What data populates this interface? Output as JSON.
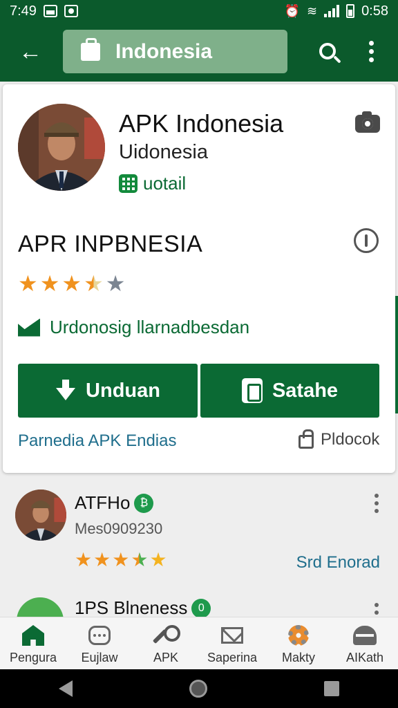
{
  "status_bar": {
    "time": "7:49",
    "battery_time": "0:58"
  },
  "app_bar": {
    "search_text": "Indonesia"
  },
  "app_card": {
    "title": "APK Indonesia",
    "subtitle": "Uidonesia",
    "badge_text": "uotail",
    "section_title": "APR INPBNESIA",
    "rating": 3.5,
    "rating_max": 5,
    "verified_text": "Urdonosig llarnadbesdan",
    "download_button": "Unduan",
    "save_button": "Satahe",
    "footer_link": "Parnedia APK Endias",
    "footer_lock_text": "Pldocok"
  },
  "list": [
    {
      "name": "ATFHo",
      "badge": "₿",
      "subtitle": "Mes0909230",
      "rating": 4.5,
      "action": "Srd Enorad"
    },
    {
      "name": "1PS Blneness",
      "badge": "0"
    }
  ],
  "bottom_nav": [
    {
      "label": "Pengura",
      "icon": "home-icon",
      "active": true
    },
    {
      "label": "Eujlaw",
      "icon": "chat-icon"
    },
    {
      "label": "APK",
      "icon": "wrench-icon"
    },
    {
      "label": "Saperina",
      "icon": "mail-icon"
    },
    {
      "label": "Makty",
      "icon": "gear-icon"
    },
    {
      "label": "AIKath",
      "icon": "helmet-icon"
    }
  ],
  "colors": {
    "primary": "#0b5a2c",
    "button": "#0b6a34",
    "star": "#f0921e",
    "link": "#1f6e8c"
  }
}
